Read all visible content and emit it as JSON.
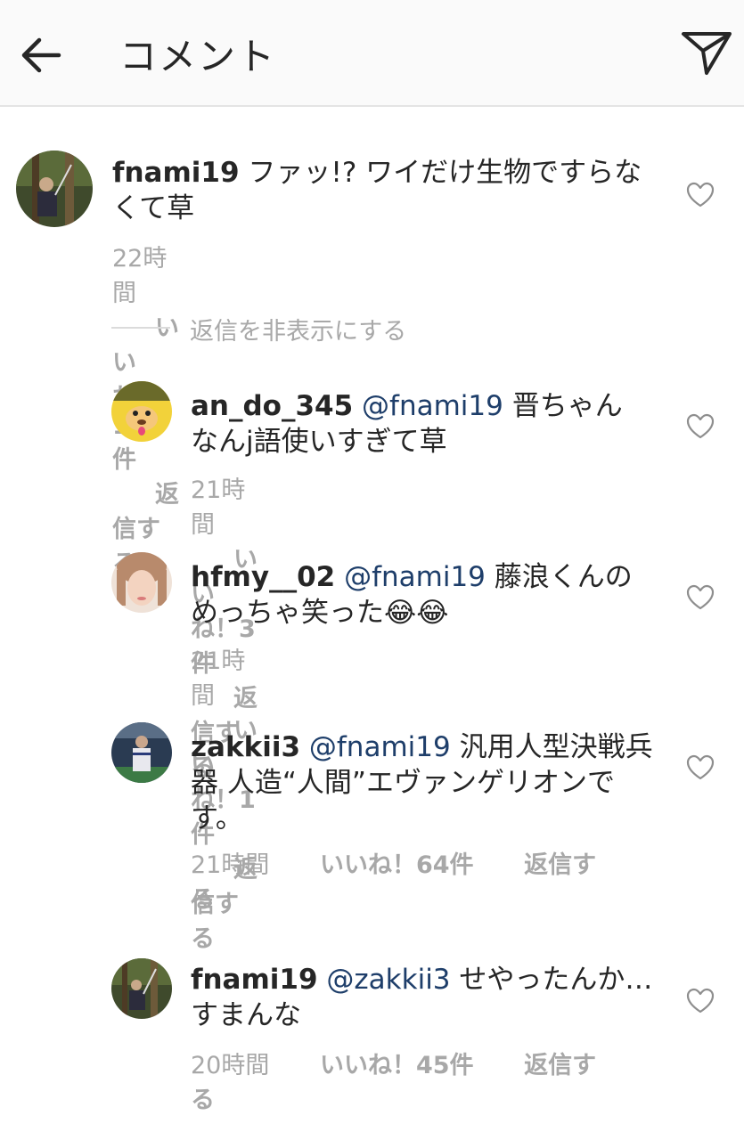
{
  "header": {
    "title": "コメント"
  },
  "hide_replies": "返信を非表示にする",
  "comments": [
    {
      "username": "fnami19",
      "mention": "",
      "body": "ファッ!? ワイだけ生物ですらなくて草",
      "time": "22時間",
      "likes": "いいね！143件",
      "reply": "返信する"
    },
    {
      "username": "an_do_345",
      "mention": "@fnami19",
      "body": "晋ちゃん なんj語使いすぎて草",
      "time": "21時間",
      "likes": "いいね！3件",
      "reply": "返信する"
    },
    {
      "username": "hfmy__02",
      "mention": "@fnami19",
      "body": "藤浪くんのめっちゃ笑った😂😂",
      "time": "21時間",
      "likes": "いいね！1件",
      "reply": "返信する"
    },
    {
      "username": "zakkii3",
      "mention": "@fnami19",
      "body": "汎用人型決戦兵器 人造“人間”エヴァンゲリオンです。",
      "time": "21時間",
      "likes": "いいね！64件",
      "reply": "返信する"
    },
    {
      "username": "fnami19",
      "mention": "@zakkii3",
      "body": "せやったんか…すまんな",
      "time": "20時間",
      "likes": "いいね！45件",
      "reply": "返信する"
    }
  ]
}
